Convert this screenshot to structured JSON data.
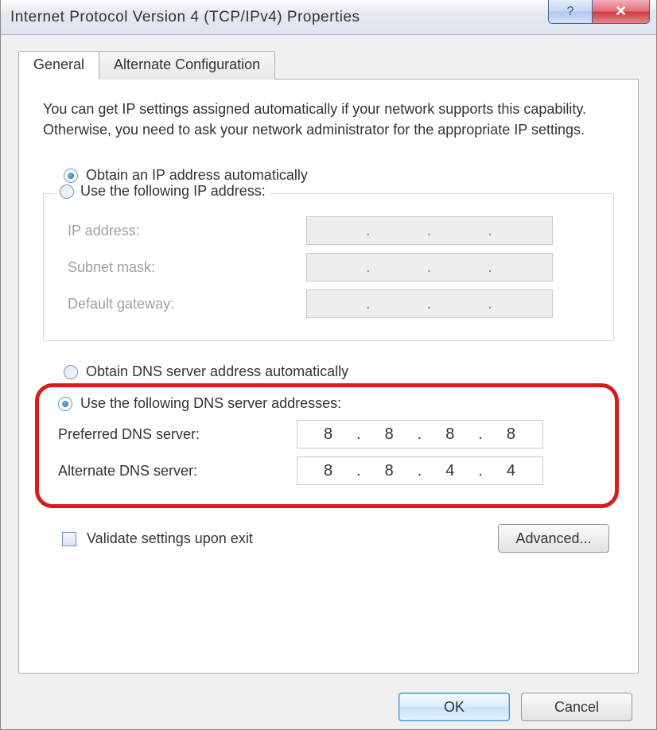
{
  "window": {
    "title": "Internet Protocol Version 4 (TCP/IPv4) Properties"
  },
  "tabs": {
    "general": "General",
    "alternate": "Alternate Configuration"
  },
  "intro": "You can get IP settings assigned automatically if your network supports this capability. Otherwise, you need to ask your network administrator for the appropriate IP settings.",
  "ip_section": {
    "obtain_auto": "Obtain an IP address automatically",
    "use_following": "Use the following IP address:",
    "ip_address_label": "IP address:",
    "subnet_label": "Subnet mask:",
    "gateway_label": "Default gateway:"
  },
  "dns_section": {
    "obtain_auto": "Obtain DNS server address automatically",
    "use_following": "Use the following DNS server addresses:",
    "preferred_label": "Preferred DNS server:",
    "alternate_label": "Alternate DNS server:",
    "preferred_value": {
      "o1": "8",
      "o2": "8",
      "o3": "8",
      "o4": "8"
    },
    "alternate_value": {
      "o1": "8",
      "o2": "8",
      "o3": "4",
      "o4": "4"
    }
  },
  "validate_label": "Validate settings upon exit",
  "buttons": {
    "advanced": "Advanced...",
    "ok": "OK",
    "cancel": "Cancel"
  }
}
